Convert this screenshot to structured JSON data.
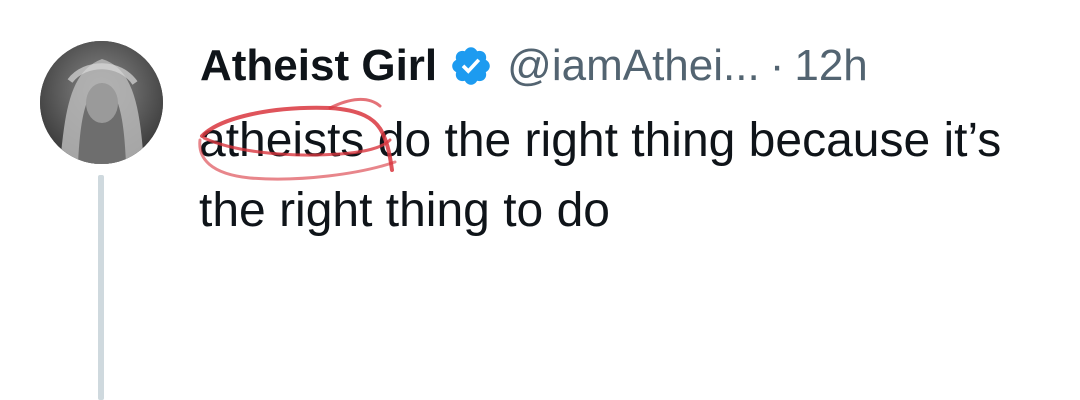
{
  "tweet": {
    "author": {
      "display_name": "Atheist Girl",
      "handle": "@iamAthei...",
      "verified": true,
      "verified_badge_icon": "verified-badge-icon",
      "avatar_icon": "avatar"
    },
    "separator": "·",
    "time": "12h",
    "text": "atheists do the right thing because it’s the right thing to do"
  },
  "colors": {
    "verified_blue": "#1d9bf0",
    "muted_text": "#536471",
    "body_text": "#0f1419",
    "thread_line": "#cfd9de",
    "scribble_red": "#d9363e"
  }
}
